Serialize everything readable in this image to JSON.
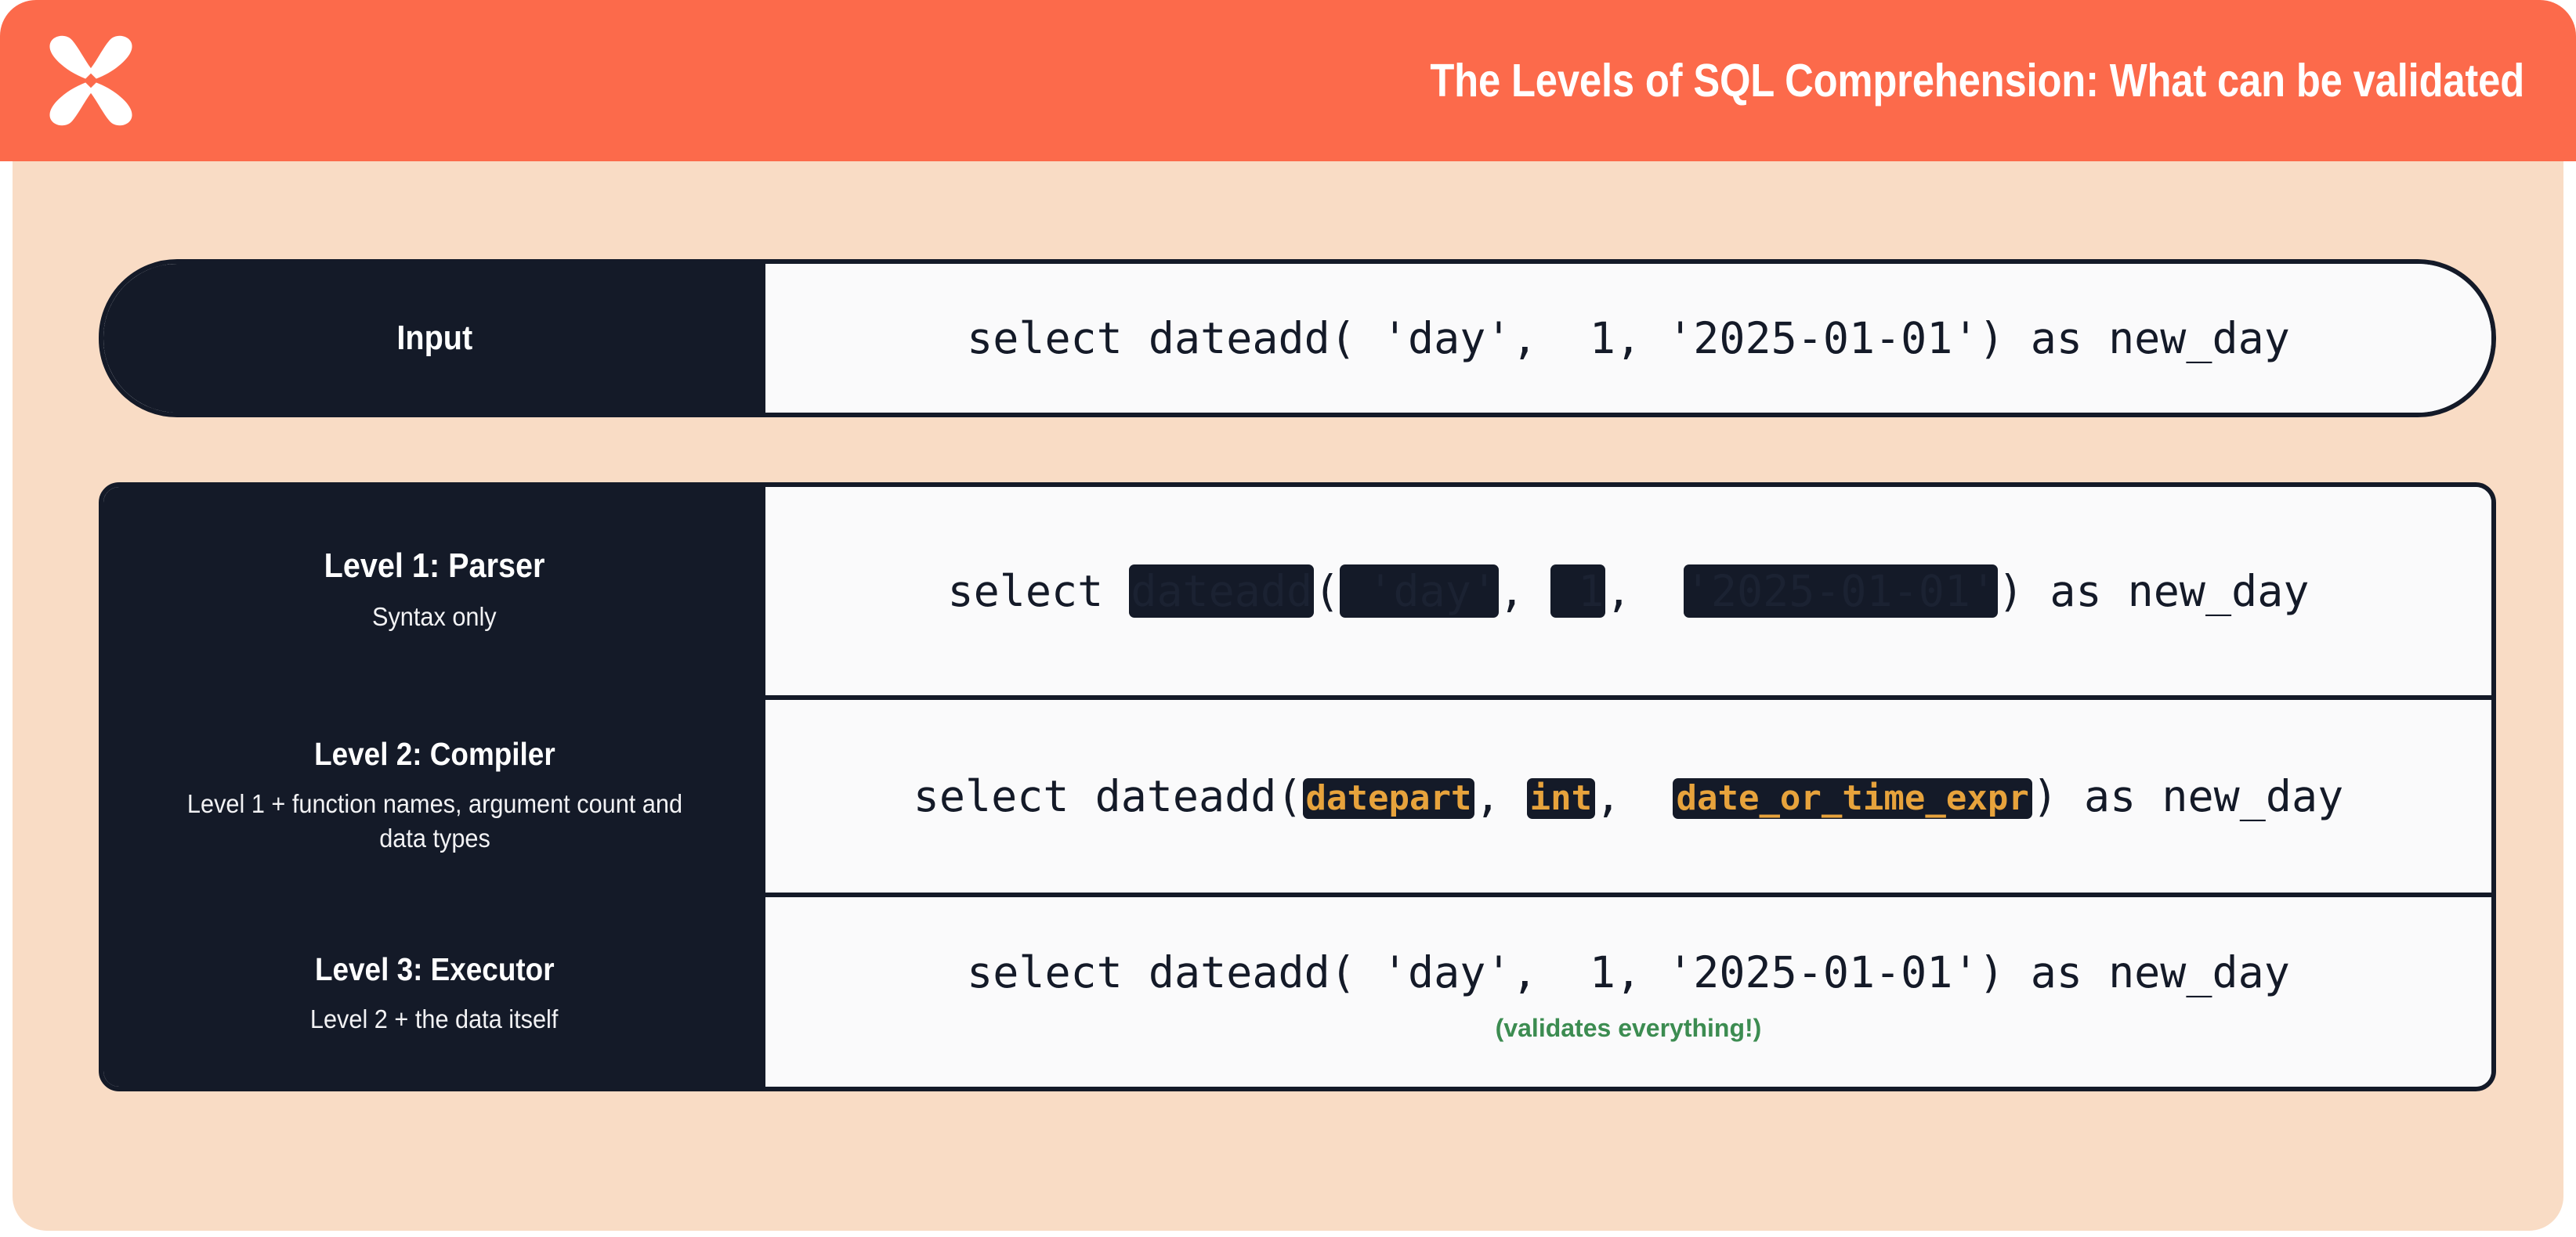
{
  "header": {
    "logo_name": "xray-logo-icon",
    "title": "The Levels of SQL Comprehension: What can be validated",
    "background_color": "#FC6A4B"
  },
  "theme": {
    "accent_orange": "#FC6A4B",
    "panel_peach": "#F9DCC5",
    "ink_navy": "#141A28",
    "code_bg": "#FAFAFB",
    "token_amber": "#E7A33C",
    "note_green": "#3C8C51"
  },
  "input_row": {
    "label": "Input",
    "code": {
      "prefix": "select dateadd( 'day',  1, '2025-01-01') as new_day"
    }
  },
  "levels": [
    {
      "title": "Level 1: Parser",
      "subtitle": "Syntax only",
      "code_segments": [
        {
          "kind": "plain",
          "text": "select "
        },
        {
          "kind": "redact",
          "text": "dateadd"
        },
        {
          "kind": "plain",
          "text": "("
        },
        {
          "kind": "redact",
          "text": " 'day'"
        },
        {
          "kind": "plain",
          "text": ", "
        },
        {
          "kind": "redact",
          "text": " 1"
        },
        {
          "kind": "plain",
          "text": ",  "
        },
        {
          "kind": "redact",
          "text": "'2025-01-01'"
        },
        {
          "kind": "plain",
          "text": ") as new_day"
        }
      ],
      "note": ""
    },
    {
      "title": "Level 2: Compiler",
      "subtitle": "Level 1 + function names, argument count and data types",
      "code_segments": [
        {
          "kind": "plain",
          "text": "select dateadd("
        },
        {
          "kind": "token",
          "text": "datepart"
        },
        {
          "kind": "plain",
          "text": ", "
        },
        {
          "kind": "token",
          "text": "int"
        },
        {
          "kind": "plain",
          "text": ",  "
        },
        {
          "kind": "token",
          "text": "date_or_time_expr"
        },
        {
          "kind": "plain",
          "text": ") as new_day"
        }
      ],
      "note": ""
    },
    {
      "title": "Level 3: Executor",
      "subtitle": "Level 2 + the data itself",
      "code_segments": [
        {
          "kind": "plain",
          "text": "select dateadd( 'day',  1, '2025-01-01') as new_day"
        }
      ],
      "note": "(validates everything!)"
    }
  ]
}
